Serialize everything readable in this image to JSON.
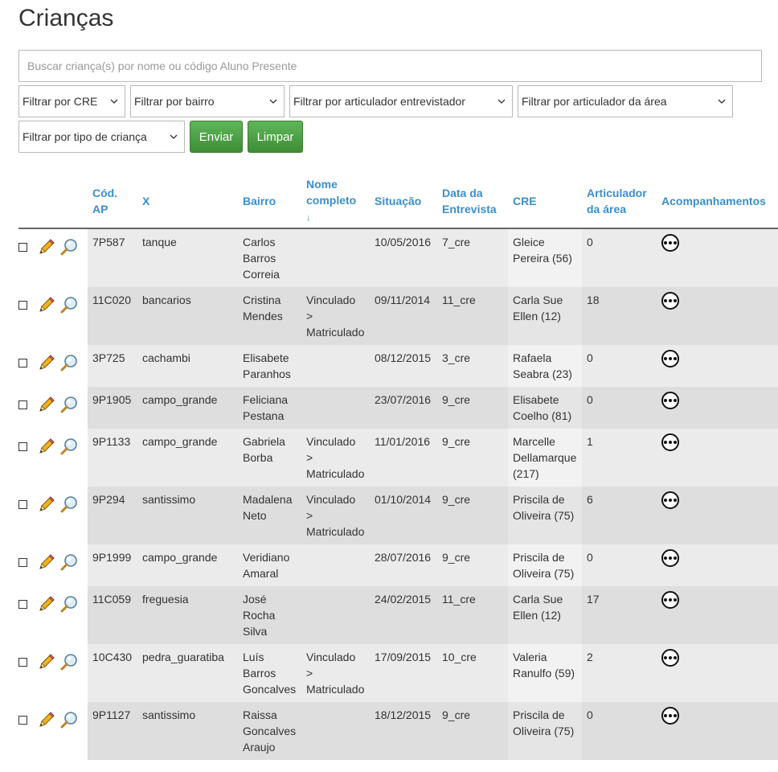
{
  "page": {
    "title": "Crianças"
  },
  "search": {
    "placeholder": "Buscar criança(s) por nome ou código Aluno Presente"
  },
  "filters": {
    "cre": "Filtrar por CRE",
    "bairro": "Filtrar por bairro",
    "articulador_entrevistador": "Filtrar por articulador entrevistador",
    "articulador_area": "Filtrar por articulador da área",
    "tipo_crianca": "Filtrar por tipo de criança"
  },
  "buttons": {
    "enviar": "Enviar",
    "limpar": "Limpar"
  },
  "table": {
    "headers": {
      "cod_ap": "Cód. AP",
      "x": "X",
      "bairro": "Bairro",
      "nome_completo": "Nome completo",
      "sort_icon": "↓",
      "situacao": "Situação",
      "data_entrevista": "Data da Entrevista",
      "cre": "CRE",
      "articulador_area": "Articulador da área",
      "acompanhamentos": "Acompanhamentos"
    },
    "rows": [
      {
        "cod": "7P587",
        "x": "tanque",
        "bairro": "Carlos Barros Correia",
        "nome": "",
        "situacao": "10/05/2016",
        "data": "7_cre",
        "cre": "Gleice Pereira (56)",
        "articulador": "0"
      },
      {
        "cod": "11C020",
        "x": "bancarios",
        "bairro": "Cristina Mendes",
        "nome": "Vinculado > Matriculado",
        "situacao": "09/11/2014",
        "data": "11_cre",
        "cre": "Carla Sue Ellen (12)",
        "articulador": "18"
      },
      {
        "cod": "3P725",
        "x": "cachambi",
        "bairro": "Elisabete Paranhos",
        "nome": "",
        "situacao": "08/12/2015",
        "data": "3_cre",
        "cre": "Rafaela Seabra (23)",
        "articulador": "0"
      },
      {
        "cod": "9P1905",
        "x": "campo_grande",
        "bairro": "Feliciana Pestana",
        "nome": "",
        "situacao": "23/07/2016",
        "data": "9_cre",
        "cre": "Elisabete Coelho (81)",
        "articulador": "0"
      },
      {
        "cod": "9P1133",
        "x": "campo_grande",
        "bairro": "Gabriela Borba",
        "nome": "Vinculado > Matriculado",
        "situacao": "11/01/2016",
        "data": "9_cre",
        "cre": "Marcelle Dellamarque (217)",
        "articulador": "1"
      },
      {
        "cod": "9P294",
        "x": "santissimo",
        "bairro": "Madalena Neto",
        "nome": "Vinculado > Matriculado",
        "situacao": "01/10/2014",
        "data": "9_cre",
        "cre": "Priscila de Oliveira (75)",
        "articulador": "6"
      },
      {
        "cod": "9P1999",
        "x": "campo_grande",
        "bairro": "Veridiano Amaral",
        "nome": "",
        "situacao": "28/07/2016",
        "data": "9_cre",
        "cre": "Priscila de Oliveira (75)",
        "articulador": "0"
      },
      {
        "cod": "11C059",
        "x": "freguesia",
        "bairro": "José Rocha Silva",
        "nome": "",
        "situacao": "24/02/2015",
        "data": "11_cre",
        "cre": "Carla Sue Ellen (12)",
        "articulador": "17"
      },
      {
        "cod": "10C430",
        "x": "pedra_guaratiba",
        "bairro": "Luís Barros Goncalves",
        "nome": "Vinculado > Matriculado",
        "situacao": "17/09/2015",
        "data": "10_cre",
        "cre": "Valeria Ranulfo (59)",
        "articulador": "2"
      },
      {
        "cod": "9P1127",
        "x": "santissimo",
        "bairro": "Raissa Goncalves Araujo",
        "nome": "",
        "situacao": "18/12/2015",
        "data": "9_cre",
        "cre": "Priscila de Oliveira (75)",
        "articulador": "0"
      }
    ]
  },
  "icons": {
    "edit": "pencil-icon",
    "view": "magnifier-icon",
    "more": "ellipsis-circle-icon",
    "dropdown": "chevron-down-icon"
  },
  "colors": {
    "header_link": "#3a8fce",
    "button_green": "#4aa043"
  }
}
